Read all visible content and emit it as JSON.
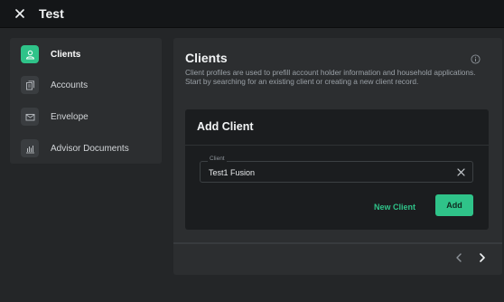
{
  "window": {
    "title": "Test",
    "close_icon": "close-icon"
  },
  "sidebar": {
    "items": [
      {
        "label": "Clients",
        "icon": "person-icon",
        "active": true
      },
      {
        "label": "Accounts",
        "icon": "document-icon",
        "active": false
      },
      {
        "label": "Envelope",
        "icon": "mail-icon",
        "active": false
      },
      {
        "label": "Advisor Documents",
        "icon": "bar-chart-icon",
        "active": false
      }
    ]
  },
  "main": {
    "title": "Clients",
    "description": "Client profiles are used to prefill account holder information and household applications. Start by searching for an existing client or creating a new client record.",
    "info_icon": "info-icon"
  },
  "card": {
    "title": "Add Client",
    "client_field": {
      "label": "Client",
      "value": "Test1 Fusion"
    },
    "new_client_label": "New Client",
    "add_label": "Add"
  },
  "pagination": {
    "prev_icon": "chevron-left-icon",
    "next_icon": "chevron-right-icon"
  },
  "colors": {
    "accent": "#2fc389",
    "background": "#242628",
    "panel": "#2c2e30",
    "card": "#1b1d1f"
  }
}
